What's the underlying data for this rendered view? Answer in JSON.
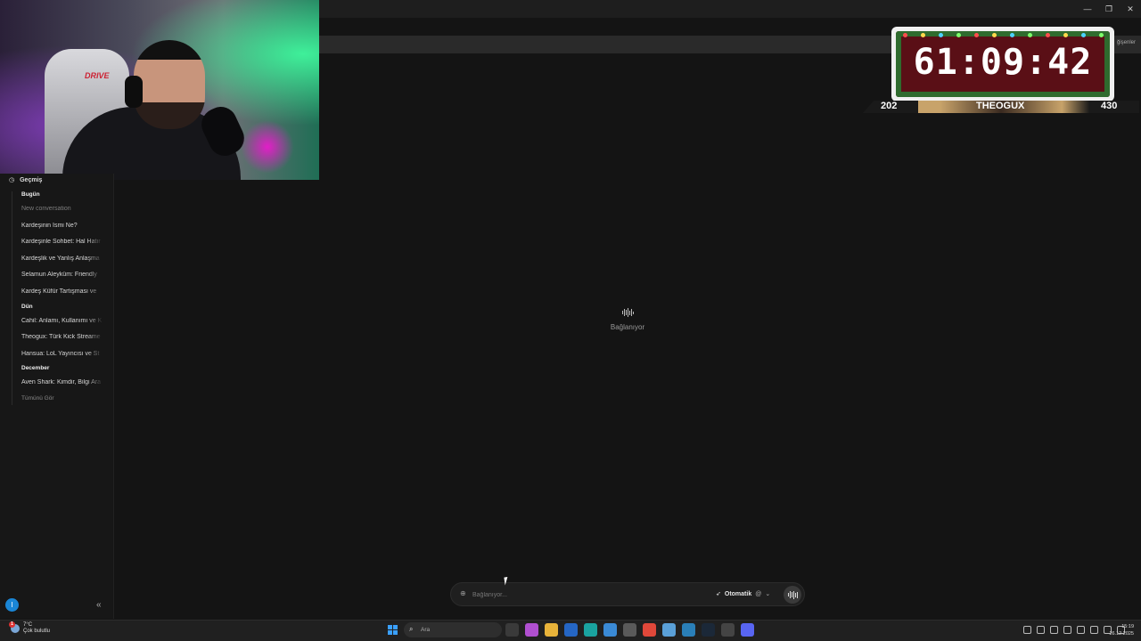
{
  "timer": {
    "value": "61:09:42"
  },
  "stream_stats": {
    "left": "202",
    "name": "THEOGUX",
    "right": "430"
  },
  "sidebar": {
    "history_label": "Geçmiş",
    "sections": [
      {
        "label": "Bugün",
        "items": [
          {
            "label": "New conversation",
            "muted": true
          },
          {
            "label": "Kardeşinin İsmi Ne?"
          },
          {
            "label": "Kardeşinle Sohbet: Hal Hatır"
          },
          {
            "label": "Kardeşlik ve Yanlış Anlaşma"
          },
          {
            "label": "Selamun Aleyküm: Friendly"
          },
          {
            "label": "Kardeş Küfür Tartışması ve"
          }
        ]
      },
      {
        "label": "Dün",
        "items": [
          {
            "label": "Cahil: Anlamı, Kullanımı ve K"
          },
          {
            "label": "Theogux: Türk Kick Streame"
          },
          {
            "label": "Hansua: LoL Yayıncısı ve St"
          }
        ]
      },
      {
        "label": "December",
        "items": [
          {
            "label": "Aven Shark: Kimdir, Bilgi Ara"
          }
        ]
      }
    ],
    "see_all": "Tümünü Gör",
    "account_initial": "I",
    "collapse_glyph": "«"
  },
  "main": {
    "status_text": "Bağlanıyor"
  },
  "composer": {
    "placeholder": "Bağlanıyor...",
    "mode_label": "Otomatik",
    "mode_sub": "@"
  },
  "taskbar": {
    "weather_temp": "7°C",
    "weather_desc": "Çok bulutlu",
    "weather_badge": "1",
    "search_placeholder": "Ara",
    "time": "15:19",
    "date": "26.12.2025"
  },
  "browser": {
    "settings_label": "ğişenler"
  },
  "colors": {
    "accent": "#1a86d6",
    "timer_bg": "#5a0f16",
    "timer_frame": "#2f6b2e",
    "stats_gold": "#c8a36a"
  }
}
